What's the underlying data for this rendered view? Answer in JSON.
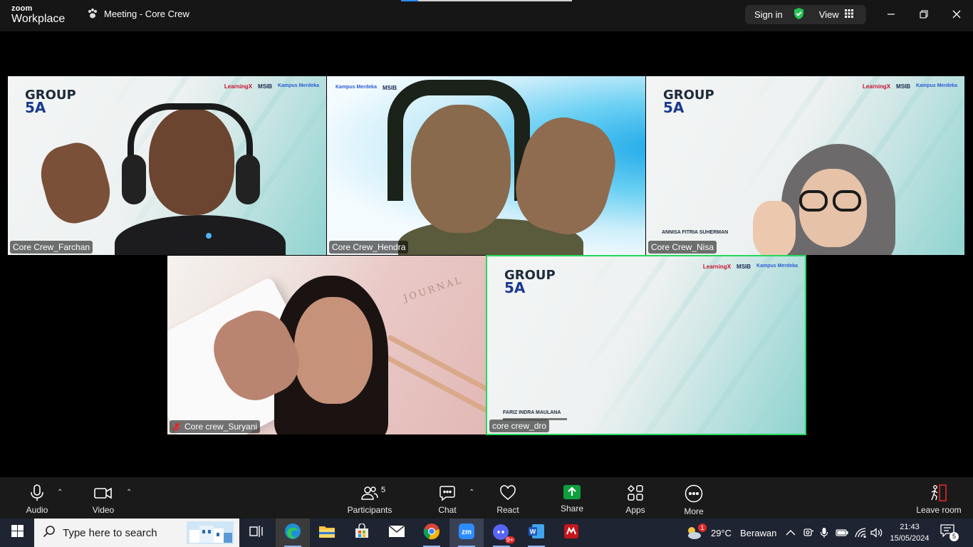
{
  "titlebar": {
    "brand_small": "zoom",
    "brand_big": "Workplace",
    "meeting_title": "Meeting - Core Crew",
    "sign_in": "Sign in",
    "view": "View",
    "loading_progress": 0.1
  },
  "tiles": [
    {
      "name": "Core Crew_Farchan",
      "muted": false,
      "active": false,
      "slide_title_1": "GROUP",
      "slide_title_2": "5A"
    },
    {
      "name": "Core Crew_Hendra",
      "muted": false,
      "active": false
    },
    {
      "name": "Core Crew_Nisa",
      "muted": false,
      "active": false,
      "slide_title_1": "GROUP",
      "slide_title_2": "5A",
      "caption": "ANNISA FITRIA SUHERMAN"
    },
    {
      "name": "Core crew_Suryani",
      "muted": true,
      "active": false,
      "journal": "JOURNAL"
    },
    {
      "name": "core crew_dro",
      "muted": false,
      "active": true,
      "slide_title_1": "GROUP",
      "slide_title_2": "5A",
      "caption": "FARIZ INDRA MAULANA"
    }
  ],
  "slide_logos": {
    "learning": "LearningX",
    "msib": "MSIB",
    "kampus": "Kampus Merdeka"
  },
  "toolbar": {
    "audio": "Audio",
    "video": "Video",
    "participants": "Participants",
    "participants_count": "5",
    "chat": "Chat",
    "react": "React",
    "share": "Share",
    "apps": "Apps",
    "more": "More",
    "leave": "Leave room"
  },
  "taskbar": {
    "search_placeholder": "Type here to search",
    "weather_temp": "29°C",
    "weather_text": "Berawan",
    "weather_badge": "1",
    "time": "21:43",
    "date": "15/05/2024",
    "notifications": "5",
    "discord_badge": "9+"
  },
  "colors": {
    "active_speaker": "#23d959",
    "share_green": "#0e9f3d",
    "zoom_blue": "#2d8cff",
    "leave_red": "#e02828"
  }
}
